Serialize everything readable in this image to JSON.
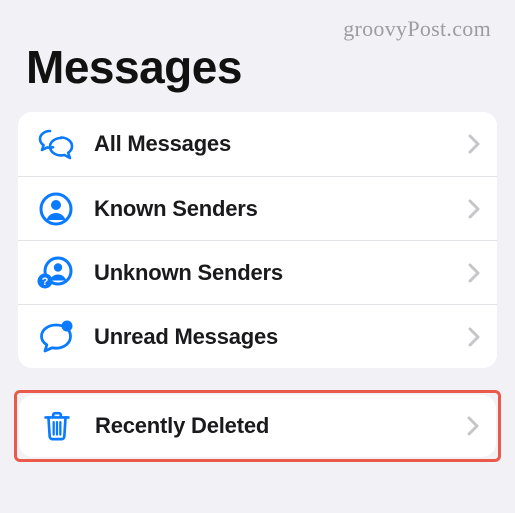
{
  "watermark": "groovyPost.com",
  "page_title": "Messages",
  "filters": {
    "all": {
      "label": "All Messages",
      "icon": "messages-icon"
    },
    "known": {
      "label": "Known Senders",
      "icon": "known-senders-icon"
    },
    "unknown": {
      "label": "Unknown Senders",
      "icon": "unknown-senders-icon"
    },
    "unread": {
      "label": "Unread Messages",
      "icon": "unread-messages-icon"
    }
  },
  "recently_deleted": {
    "label": "Recently Deleted",
    "icon": "trash-icon"
  },
  "colors": {
    "accent": "#0a7aff",
    "highlight_border": "#ea5a4a"
  }
}
